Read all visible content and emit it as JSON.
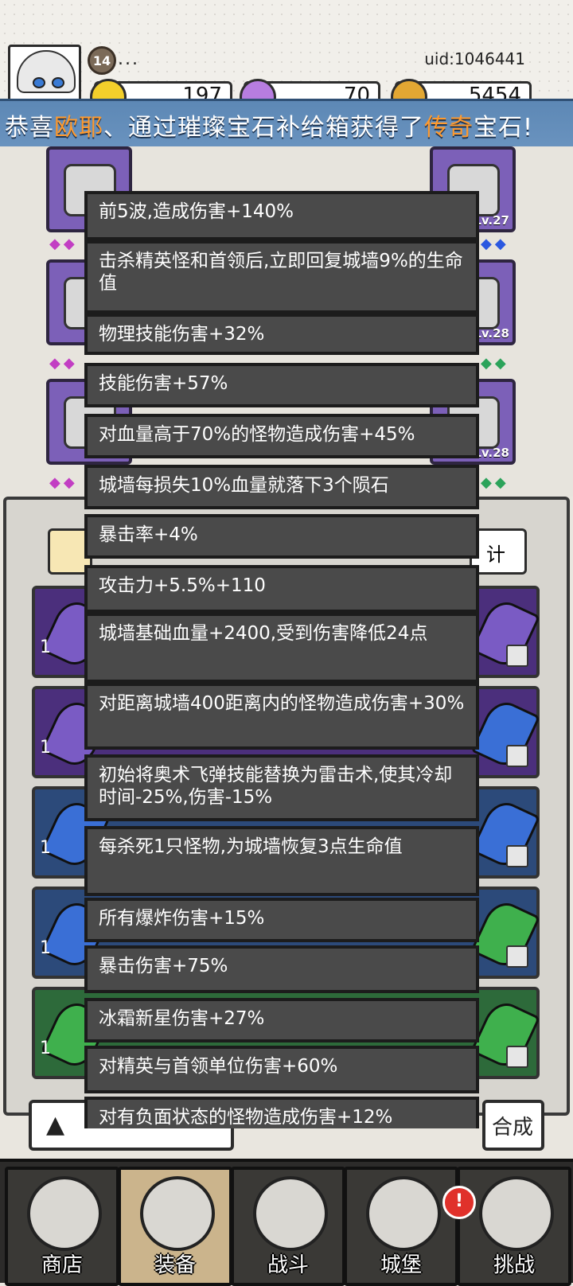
{
  "player": {
    "level": "14",
    "name": "...",
    "uid": "uid:1046441"
  },
  "currencies": [
    {
      "name": "gold",
      "value": "197",
      "color": "#f3cf2b"
    },
    {
      "name": "diamond",
      "value": "70",
      "color": "#b77de0"
    },
    {
      "name": "coin",
      "value": "5454",
      "color": "#e2a733"
    }
  ],
  "banner": {
    "prefix": "恭喜",
    "player": "欧耶",
    "middle": "、通过璀璨宝石补给箱获得了",
    "rarity": "传奇",
    "suffix": "宝石!"
  },
  "equipment": {
    "right_levels": [
      "Lv.27",
      "Lv.28",
      "Lv.28"
    ]
  },
  "buttons": {
    "stat_label": "计",
    "merge_label": "合成"
  },
  "gem_counts": [
    "1",
    "1",
    "1",
    "1",
    "1"
  ],
  "stats": [
    "前5波,造成伤害+140%",
    "击杀精英怪和首领后,立即回复城墙9%的生命值",
    "物理技能伤害+32%",
    "技能伤害+57%",
    "对血量高于70%的怪物造成伤害+45%",
    "城墙每损失10%血量就落下3个陨石",
    "暴击率+4%",
    "攻击力+5.5%+110",
    "城墙基础血量+2400,受到伤害降低24点",
    "对距离城墙400距离内的怪物造成伤害+30%",
    "初始将奥术飞弹技能替换为雷击术,使其冷却时间-25%,伤害-15%",
    "每杀死1只怪物,为城墙恢复3点生命值",
    "所有爆炸伤害+15%",
    "暴击伤害+75%",
    "冰霜新星伤害+27%",
    "对精英与首领单位伤害+60%",
    "对有负面状态的怪物造成伤害+12%"
  ],
  "nav": [
    {
      "label": "商店",
      "icon": "shop-icon"
    },
    {
      "label": "装备",
      "icon": "equipment-icon"
    },
    {
      "label": "战斗",
      "icon": "battle-icon"
    },
    {
      "label": "城堡",
      "icon": "castle-icon"
    },
    {
      "label": "挑战",
      "icon": "challenge-icon"
    }
  ],
  "notification": "!"
}
